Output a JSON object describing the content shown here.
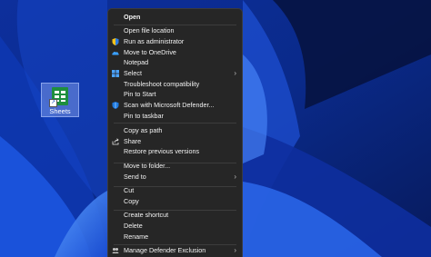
{
  "desktop": {
    "icon_label": "Sheets"
  },
  "menu": {
    "open": "Open",
    "open_file_location": "Open file location",
    "run_as_admin": "Run as administrator",
    "move_to_onedrive": "Move to OneDrive",
    "notepad": "Notepad",
    "select": "Select",
    "troubleshoot": "Troubleshoot compatibility",
    "pin_to_start": "Pin to Start",
    "scan_defender": "Scan with Microsoft Defender...",
    "pin_to_taskbar": "Pin to taskbar",
    "copy_as_path": "Copy as path",
    "share": "Share",
    "restore_versions": "Restore previous versions",
    "move_to_folder": "Move to folder...",
    "send_to": "Send to",
    "cut": "Cut",
    "copy": "Copy",
    "create_shortcut": "Create shortcut",
    "delete": "Delete",
    "rename": "Rename",
    "manage_defender_exclusion": "Manage Defender Exclusion"
  },
  "colors": {
    "menu_bg": "#262626",
    "menu_text": "#f2f2f2",
    "wallpaper_dark": "#0a1a5c",
    "wallpaper_bright": "#2f6ff0"
  },
  "icons": {
    "run_as_admin": "shield-icon",
    "move_to_onedrive": "onedrive-cloud-icon",
    "select": "windows-select-icon",
    "scan_defender": "defender-shield-icon",
    "share": "share-icon",
    "manage_defender_exclusion": "defender-exclusion-icon",
    "submenu": "chevron-right-icon"
  }
}
